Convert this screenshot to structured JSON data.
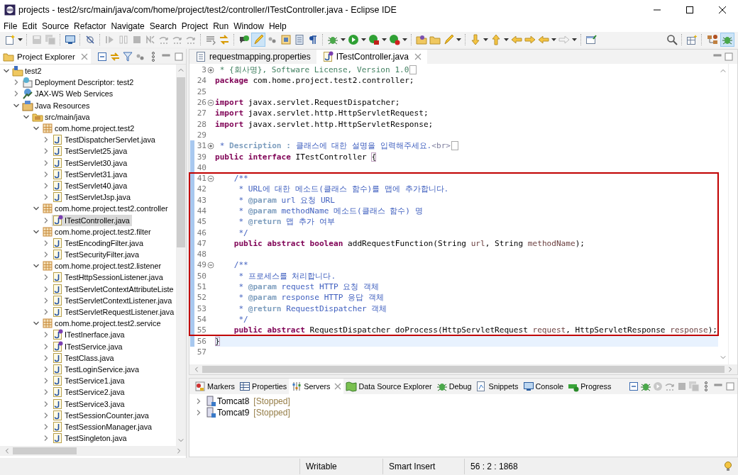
{
  "window": {
    "title": "projects - test2/src/main/java/com/home/project/test2/controller/ITestController.java - Eclipse IDE"
  },
  "menu": [
    "File",
    "Edit",
    "Source",
    "Refactor",
    "Navigate",
    "Search",
    "Project",
    "Run",
    "Window",
    "Help"
  ],
  "toolbar": {
    "mark_occurrences": {
      "on": true
    }
  },
  "perspectives": [
    {
      "kind": "javaee",
      "selected": false
    },
    {
      "kind": "debug",
      "selected": true
    }
  ],
  "explorer": {
    "title": "Project Explorer",
    "tree": [
      {
        "label": "test2",
        "kind": "project",
        "expanded": true,
        "selected": false,
        "children": [
          {
            "label": "Deployment Descriptor: test2",
            "kind": "descriptor",
            "expanded": false,
            "selected": false
          },
          {
            "label": "JAX-WS Web Services",
            "kind": "webservices",
            "expanded": false,
            "selected": false
          },
          {
            "label": "Java Resources",
            "kind": "resources",
            "expanded": true,
            "selected": false,
            "children": [
              {
                "label": "src/main/java",
                "kind": "source-folder",
                "expanded": true,
                "selected": false,
                "children": [
                  {
                    "label": "com.home.project.test2",
                    "kind": "package",
                    "expanded": true,
                    "selected": false,
                    "children": [
                      {
                        "label": "TestDispatcherServlet.java",
                        "kind": "java",
                        "expanded": false,
                        "selected": false
                      },
                      {
                        "label": "TestServlet25.java",
                        "kind": "java",
                        "expanded": false,
                        "selected": false
                      },
                      {
                        "label": "TestServlet30.java",
                        "kind": "java",
                        "expanded": false,
                        "selected": false
                      },
                      {
                        "label": "TestServlet31.java",
                        "kind": "java",
                        "expanded": false,
                        "selected": false
                      },
                      {
                        "label": "TestServlet40.java",
                        "kind": "java",
                        "expanded": false,
                        "selected": false
                      },
                      {
                        "label": "TestServletJsp.java",
                        "kind": "java",
                        "expanded": false,
                        "selected": false
                      }
                    ]
                  },
                  {
                    "label": "com.home.project.test2.controller",
                    "kind": "package",
                    "expanded": true,
                    "selected": false,
                    "children": [
                      {
                        "label": "ITestController.java",
                        "kind": "interface",
                        "expanded": false,
                        "selected": true
                      }
                    ]
                  },
                  {
                    "label": "com.home.project.test2.filter",
                    "kind": "package",
                    "expanded": true,
                    "selected": false,
                    "children": [
                      {
                        "label": "TestEncodingFilter.java",
                        "kind": "java",
                        "expanded": false,
                        "selected": false
                      },
                      {
                        "label": "TestSecurityFilter.java",
                        "kind": "java",
                        "expanded": false,
                        "selected": false
                      }
                    ]
                  },
                  {
                    "label": "com.home.project.test2.listener",
                    "kind": "package",
                    "expanded": true,
                    "selected": false,
                    "children": [
                      {
                        "label": "TestHttpSessionListener.java",
                        "kind": "java",
                        "expanded": false,
                        "selected": false
                      },
                      {
                        "label": "TestServletContextAttributeListe",
                        "kind": "java",
                        "expanded": false,
                        "selected": false
                      },
                      {
                        "label": "TestServletContextListener.java",
                        "kind": "java",
                        "expanded": false,
                        "selected": false
                      },
                      {
                        "label": "TestServletRequestListener.java",
                        "kind": "java",
                        "expanded": false,
                        "selected": false
                      }
                    ]
                  },
                  {
                    "label": "com.home.project.test2.service",
                    "kind": "package",
                    "expanded": true,
                    "selected": false,
                    "children": [
                      {
                        "label": "ITestInerface.java",
                        "kind": "interface",
                        "expanded": false,
                        "selected": false
                      },
                      {
                        "label": "ITestService.java",
                        "kind": "interface",
                        "expanded": false,
                        "selected": false
                      },
                      {
                        "label": "TestClass.java",
                        "kind": "java",
                        "expanded": false,
                        "selected": false
                      },
                      {
                        "label": "TestLoginService.java",
                        "kind": "java",
                        "expanded": false,
                        "selected": false
                      },
                      {
                        "label": "TestService1.java",
                        "kind": "java",
                        "expanded": false,
                        "selected": false
                      },
                      {
                        "label": "TestService2.java",
                        "kind": "java",
                        "expanded": false,
                        "selected": false
                      },
                      {
                        "label": "TestService3.java",
                        "kind": "java",
                        "expanded": false,
                        "selected": false
                      },
                      {
                        "label": "TestSessionCounter.java",
                        "kind": "java",
                        "expanded": false,
                        "selected": false
                      },
                      {
                        "label": "TestSessionManager.java",
                        "kind": "java",
                        "expanded": false,
                        "selected": false
                      },
                      {
                        "label": "TestSingleton.java",
                        "kind": "java",
                        "expanded": false,
                        "selected": false
                      }
                    ]
                  }
                ]
              }
            ]
          }
        ]
      }
    ]
  },
  "editor": {
    "tabs": [
      {
        "label": "requestmapping.properties",
        "kind": "properties",
        "selected": false
      },
      {
        "label": "ITestController.java",
        "kind": "interface",
        "selected": true
      }
    ],
    "blocks": [
      {
        "boxed": false,
        "lines": [
          {
            "n": "3",
            "folded": true,
            "changed": false,
            "current": false,
            "segs": [
              {
                "kind": "comment",
                "t": " * {회사명}, Software License, Version 1.0"
              }
            ]
          },
          {
            "n": "24",
            "changed": false,
            "current": false,
            "segs": [
              {
                "kind": "kw",
                "t": "package"
              },
              {
                "kind": "plain",
                "t": " com.home.project.test2.controller;"
              }
            ]
          },
          {
            "n": "25",
            "changed": false,
            "current": false
          },
          {
            "n": "26",
            "folded": false,
            "changed": false,
            "current": false,
            "segs": [
              {
                "kind": "kw",
                "t": "import"
              },
              {
                "kind": "plain",
                "t": " javax.servlet.RequestDispatcher;"
              }
            ]
          },
          {
            "n": "27",
            "changed": false,
            "current": false,
            "segs": [
              {
                "kind": "kw",
                "t": "import"
              },
              {
                "kind": "plain",
                "t": " javax.servlet.http.HttpServletRequest;"
              }
            ]
          },
          {
            "n": "28",
            "changed": false,
            "current": false,
            "segs": [
              {
                "kind": "kw",
                "t": "import"
              },
              {
                "kind": "plain",
                "t": " javax.servlet.http.HttpServletResponse;"
              }
            ]
          },
          {
            "n": "29",
            "changed": false,
            "current": false
          },
          {
            "n": "31",
            "folded": true,
            "changed": true,
            "current": false,
            "segs": [
              {
                "kind": "doc",
                "t": " * "
              },
              {
                "kind": "tag",
                "t": "Description :"
              },
              {
                "kind": "doc",
                "t": " 클래스에 대한 설명을 입력해주세요."
              },
              {
                "kind": "html",
                "t": "<br>"
              }
            ]
          },
          {
            "n": "39",
            "changed": true,
            "current": false,
            "segs": [
              {
                "kind": "kw",
                "t": "public interface"
              },
              {
                "kind": "plain",
                "t": " ITestController "
              },
              {
                "kind": "bracket",
                "t": "{"
              }
            ]
          },
          {
            "n": "40",
            "changed": true,
            "current": false
          }
        ]
      },
      {
        "boxed": true,
        "lines": [
          {
            "n": "41",
            "folded": false,
            "changed": true,
            "current": false,
            "segs": [
              {
                "kind": "doc",
                "t": "    /**"
              }
            ]
          },
          {
            "n": "42",
            "changed": true,
            "current": false,
            "segs": [
              {
                "kind": "doc",
                "t": "     * URL에 대한 메소드(클래스 함수)를 맵에 추가합니다."
              }
            ]
          },
          {
            "n": "43",
            "changed": true,
            "current": false,
            "segs": [
              {
                "kind": "doc",
                "t": "     * "
              },
              {
                "kind": "tag",
                "t": "@param"
              },
              {
                "kind": "doc",
                "t": " url 요청 URL"
              }
            ]
          },
          {
            "n": "44",
            "changed": true,
            "current": false,
            "segs": [
              {
                "kind": "doc",
                "t": "     * "
              },
              {
                "kind": "tag",
                "t": "@param"
              },
              {
                "kind": "doc",
                "t": " methodName 메소드(클래스 함수) 명"
              }
            ]
          },
          {
            "n": "45",
            "changed": true,
            "current": false,
            "segs": [
              {
                "kind": "doc",
                "t": "     * "
              },
              {
                "kind": "tag",
                "t": "@return"
              },
              {
                "kind": "doc",
                "t": " 맵 추가 여부"
              }
            ]
          },
          {
            "n": "46",
            "changed": true,
            "current": false,
            "segs": [
              {
                "kind": "doc",
                "t": "     */"
              }
            ]
          },
          {
            "n": "47",
            "changed": true,
            "current": false,
            "segs": [
              {
                "kind": "kw",
                "t": "    public abstract boolean"
              },
              {
                "kind": "plain",
                "t": " addRequestFunction(String "
              },
              {
                "kind": "var",
                "t": "url"
              },
              {
                "kind": "plain",
                "t": ", String "
              },
              {
                "kind": "var",
                "t": "methodName"
              },
              {
                "kind": "plain",
                "t": ");"
              }
            ]
          },
          {
            "n": "48",
            "changed": true,
            "current": false
          },
          {
            "n": "49",
            "folded": false,
            "changed": true,
            "current": false,
            "segs": [
              {
                "kind": "doc",
                "t": "    /**"
              }
            ]
          },
          {
            "n": "50",
            "changed": true,
            "current": false,
            "segs": [
              {
                "kind": "doc",
                "t": "     * 프로세스를 처리합니다."
              }
            ]
          },
          {
            "n": "51",
            "changed": true,
            "current": false,
            "segs": [
              {
                "kind": "doc",
                "t": "     * "
              },
              {
                "kind": "tag",
                "t": "@param"
              },
              {
                "kind": "doc",
                "t": " request HTTP 요청 객체"
              }
            ]
          },
          {
            "n": "52",
            "changed": true,
            "current": false,
            "segs": [
              {
                "kind": "doc",
                "t": "     * "
              },
              {
                "kind": "tag",
                "t": "@param"
              },
              {
                "kind": "doc",
                "t": " response HTTP 응답 객체"
              }
            ]
          },
          {
            "n": "53",
            "changed": true,
            "current": false,
            "segs": [
              {
                "kind": "doc",
                "t": "     * "
              },
              {
                "kind": "tag",
                "t": "@return"
              },
              {
                "kind": "doc",
                "t": " RequestDispatcher 객체"
              }
            ]
          },
          {
            "n": "54",
            "changed": true,
            "current": false,
            "segs": [
              {
                "kind": "doc",
                "t": "     */"
              }
            ]
          },
          {
            "n": "55",
            "changed": true,
            "current": false,
            "segs": [
              {
                "kind": "kw",
                "t": "    public abstract"
              },
              {
                "kind": "plain",
                "t": " RequestDispatcher doProcess(HttpServletRequest "
              },
              {
                "kind": "var",
                "t": "request"
              },
              {
                "kind": "plain",
                "t": ", HttpServletResponse "
              },
              {
                "kind": "var",
                "t": "response"
              },
              {
                "kind": "plain",
                "t": ");"
              }
            ]
          }
        ]
      },
      {
        "boxed": false,
        "lines": [
          {
            "n": "56",
            "changed": true,
            "current": true,
            "segs": [
              {
                "kind": "bracket",
                "t": "}"
              }
            ]
          },
          {
            "n": "57",
            "changed": false,
            "current": false
          }
        ]
      }
    ]
  },
  "bottom_panel": {
    "tabs": [
      {
        "label": "Markers",
        "kind": "markers",
        "selected": false
      },
      {
        "label": "Properties",
        "kind": "properties",
        "selected": false
      },
      {
        "label": "Servers",
        "kind": "servers",
        "selected": true
      },
      {
        "label": "Data Source Explorer",
        "kind": "data-source",
        "selected": false
      },
      {
        "label": "Debug",
        "kind": "debug",
        "selected": false
      },
      {
        "label": "Snippets",
        "kind": "snippets",
        "selected": false
      },
      {
        "label": "Console",
        "kind": "console",
        "selected": false
      },
      {
        "label": "Progress",
        "kind": "progress",
        "selected": false
      }
    ],
    "servers": [
      {
        "name": "Tomcat8",
        "status": "[Stopped]",
        "expanded": false
      },
      {
        "name": "Tomcat9",
        "status": "[Stopped]",
        "expanded": false
      }
    ]
  },
  "status_bar": {
    "fields": [
      "Writable",
      "Smart Insert",
      "56 : 2 : 1868"
    ]
  }
}
